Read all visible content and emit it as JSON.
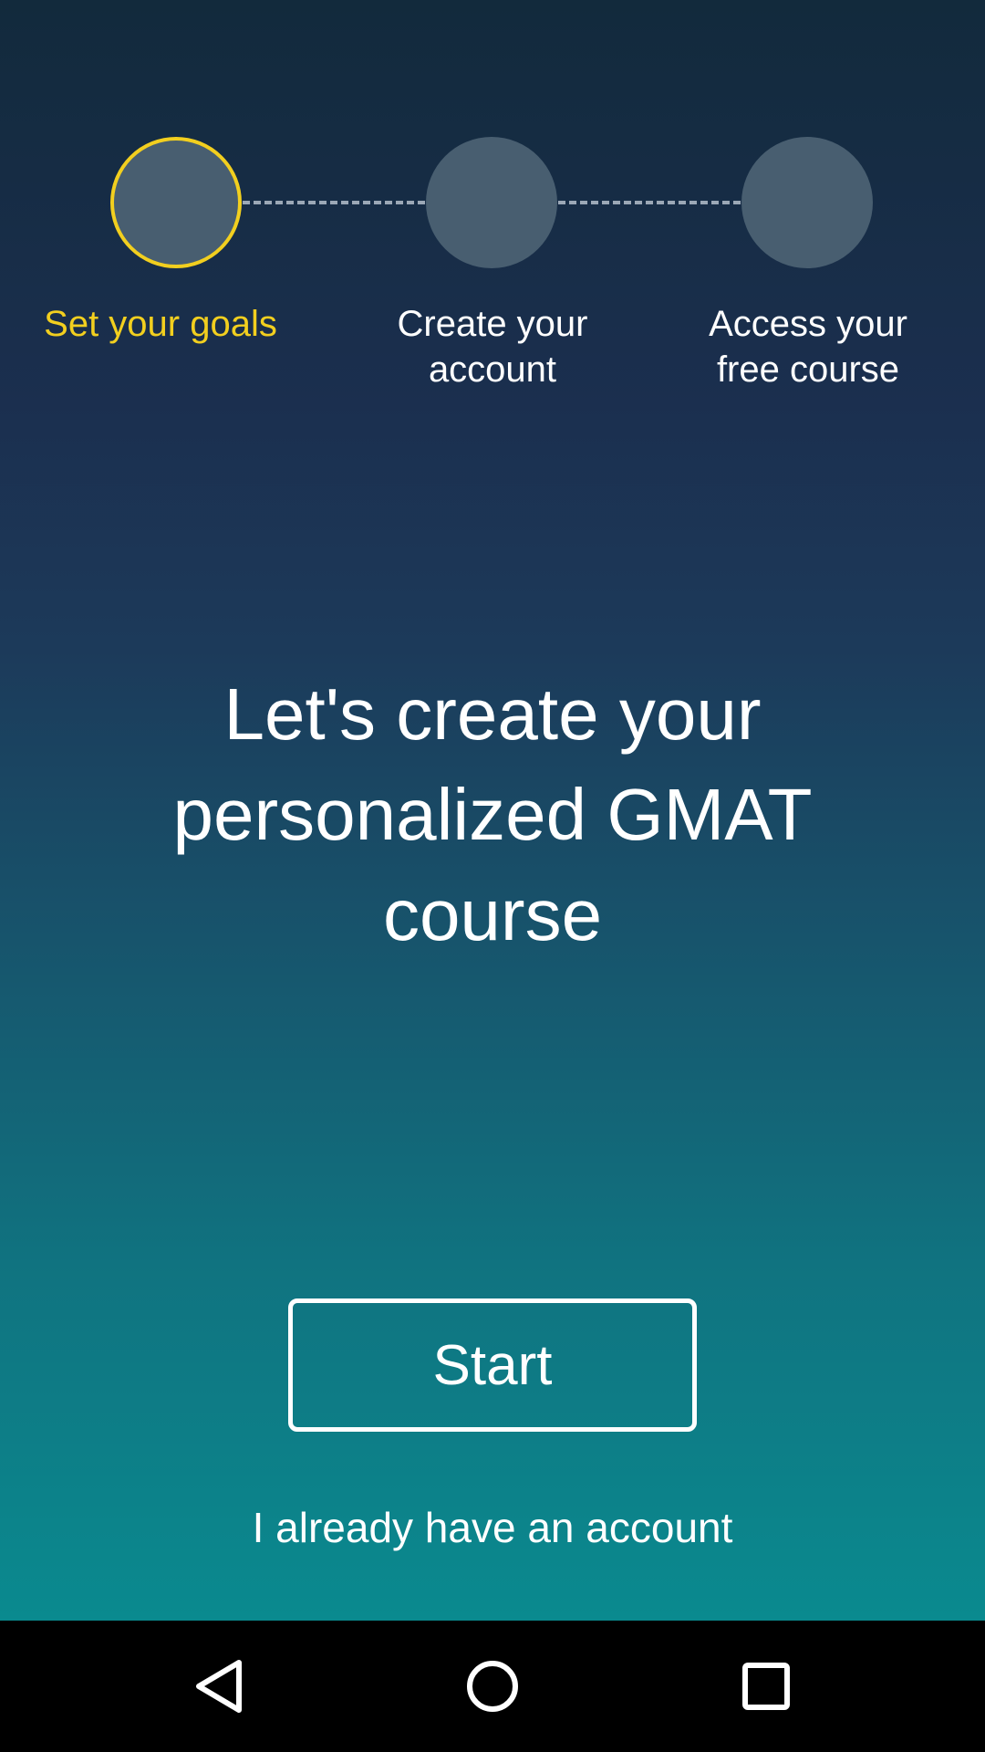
{
  "stepper": {
    "steps": [
      {
        "label": "Set your goals",
        "state": "active"
      },
      {
        "label": "Create your\naccount",
        "state": "inactive"
      },
      {
        "label": "Access your\nfree course",
        "state": "inactive"
      }
    ]
  },
  "main": {
    "headline": "Let's create your personalized GMAT course",
    "start_label": "Start",
    "account_link": "I already have an account"
  },
  "colors": {
    "accent": "#f2cf1f",
    "step_circle": "#485e70",
    "gradient_top": "#122a3c",
    "gradient_bottom": "#0a8a8f"
  },
  "navbar": {
    "icons": [
      "back-icon",
      "home-icon",
      "recent-apps-icon"
    ]
  }
}
